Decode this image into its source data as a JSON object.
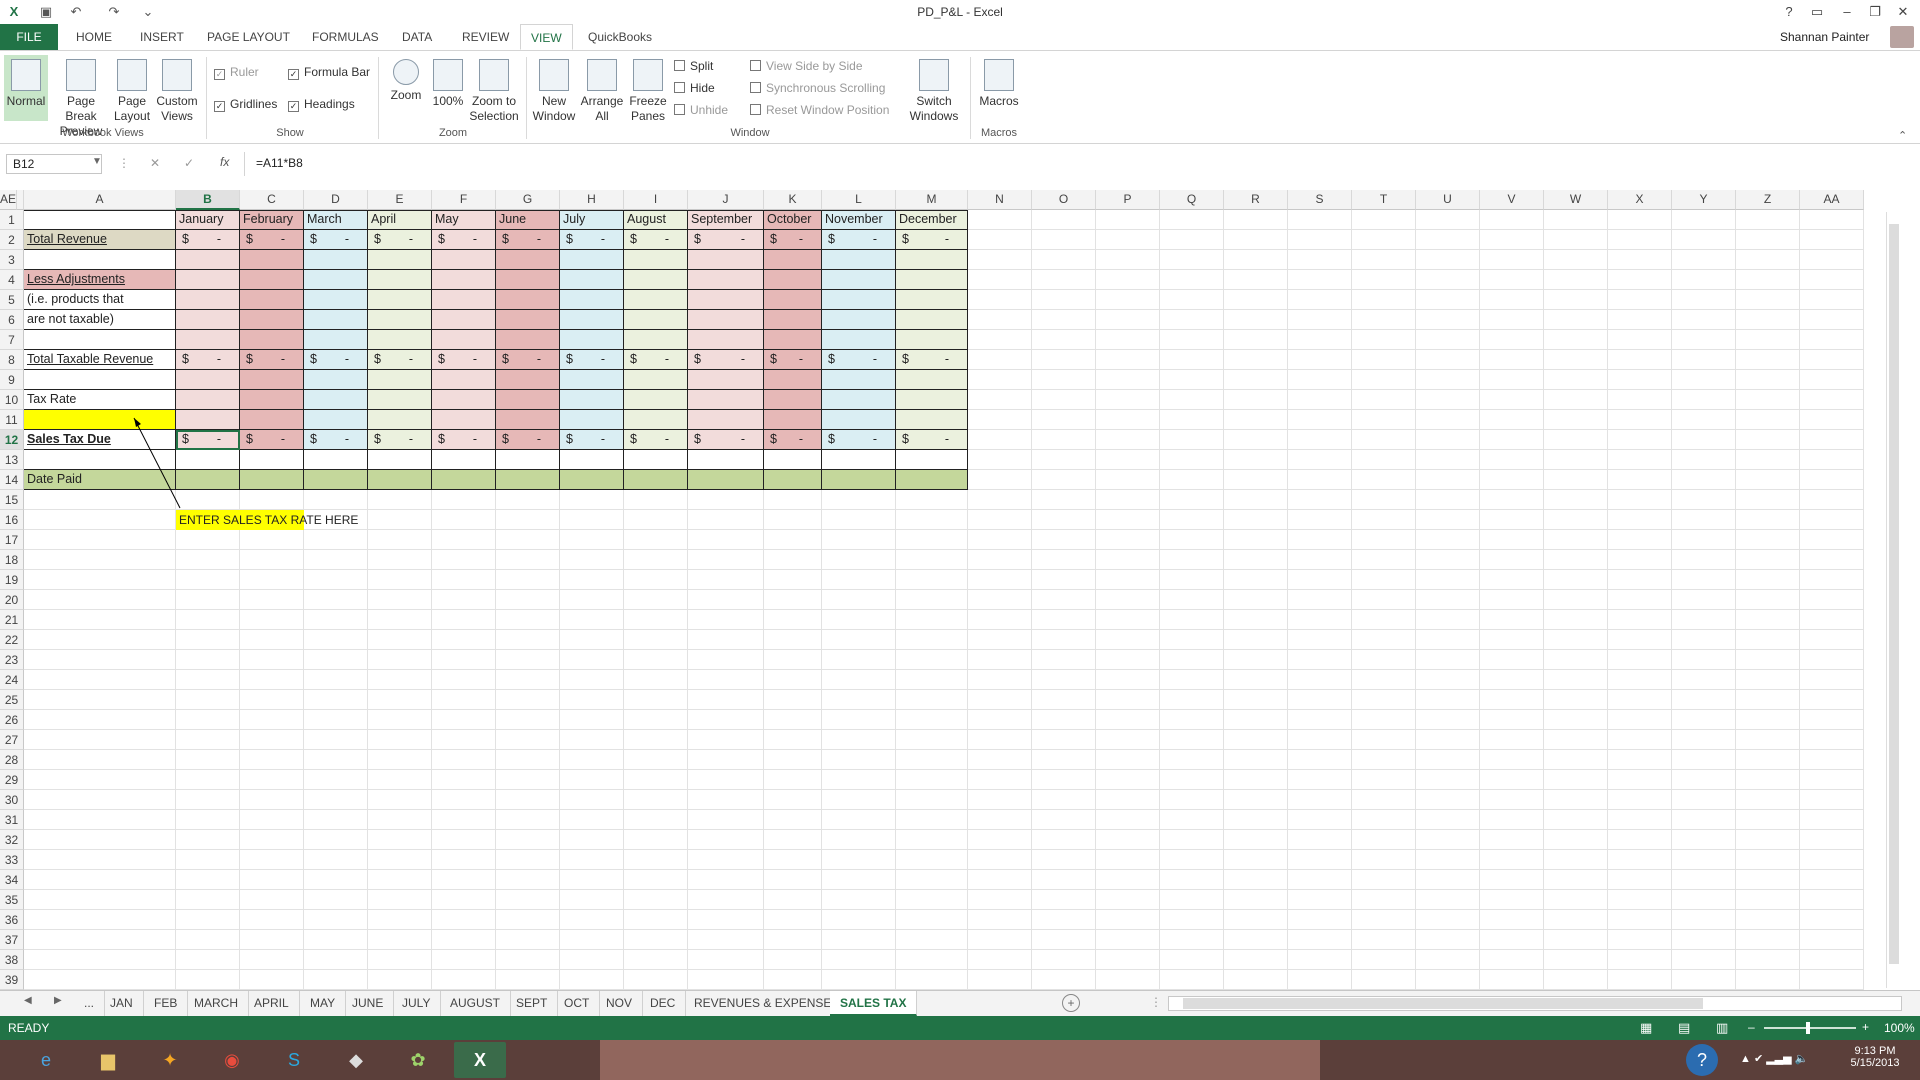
{
  "app": {
    "window_title": "PD_P&L - Excel",
    "user": "Shannan Painter"
  },
  "tabs": [
    "FILE",
    "HOME",
    "INSERT",
    "PAGE LAYOUT",
    "FORMULAS",
    "DATA",
    "REVIEW",
    "VIEW",
    "QuickBooks"
  ],
  "ribbon": {
    "workbook_views": {
      "label": "Workbook Views",
      "normal": "Normal",
      "page_break": "Page Break Preview",
      "page_layout": "Page Layout",
      "custom": "Custom Views"
    },
    "show": {
      "label": "Show",
      "ruler": "Ruler",
      "formula_bar": "Formula Bar",
      "gridlines": "Gridlines",
      "headings": "Headings"
    },
    "zoom": {
      "label": "Zoom",
      "zoom": "Zoom",
      "hundred": "100%",
      "selection": "Zoom to Selection"
    },
    "window": {
      "label": "Window",
      "new_window": "New Window",
      "arrange": "Arrange All",
      "freeze": "Freeze Panes",
      "split": "Split",
      "hide": "Hide",
      "unhide": "Unhide",
      "side": "View Side by Side",
      "sync": "Synchronous Scrolling",
      "reset": "Reset Window Position",
      "switch": "Switch Windows"
    },
    "macros": {
      "label": "Macros",
      "macros": "Macros"
    }
  },
  "formula_bar": {
    "name_box": "B12",
    "formula": "=A11*B8",
    "fx": "fx"
  },
  "columns": [
    "A",
    "B",
    "C",
    "D",
    "E",
    "F",
    "G",
    "H",
    "I",
    "J",
    "K",
    "L",
    "M",
    "N",
    "O",
    "P",
    "Q",
    "R",
    "S",
    "T",
    "U",
    "V",
    "W",
    "X",
    "Y",
    "Z",
    "AA",
    "AE"
  ],
  "months": [
    "January",
    "February",
    "March",
    "April",
    "May",
    "June",
    "July",
    "August",
    "September",
    "October",
    "November",
    "December"
  ],
  "rows_labels": {
    "total_revenue": "Total Revenue",
    "less_adj": "Less Adjustments",
    "less_adj2": "(i.e. products that",
    "less_adj3": "are not taxable)",
    "taxable": "Total Taxable Revenue",
    "tax_rate": "Tax Rate",
    "sales_tax_due": "Sales Tax Due",
    "date_paid": "Date Paid"
  },
  "dollar_cell": {
    "sign": "$",
    "dash": "-"
  },
  "callout": "ENTER SALES TAX RATE HERE",
  "sheets": [
    "...",
    "JAN",
    "FEB",
    "MARCH",
    "APRIL",
    "MAY",
    "JUNE",
    "JULY",
    "AUGUST",
    "SEPT",
    "OCT",
    "NOV",
    "DEC",
    "REVENUES & EXPENSES",
    "SALES TAX"
  ],
  "status": {
    "ready": "READY",
    "zoom": "100%"
  },
  "taskbar": {
    "time": "9:13 PM",
    "date": "5/15/2013"
  },
  "colors": {
    "excel_green": "#217346",
    "yellow": "#ffff00",
    "date_paid": "#c4d79b",
    "month_colors": [
      "#f2dcdb",
      "#e6b8b7",
      "#daeef3",
      "#ebf1de",
      "#f2dcdb",
      "#e6b8b7",
      "#daeef3",
      "#ebf1de",
      "#f2dcdb",
      "#e6b8b7",
      "#daeef3",
      "#ebf1de"
    ]
  }
}
